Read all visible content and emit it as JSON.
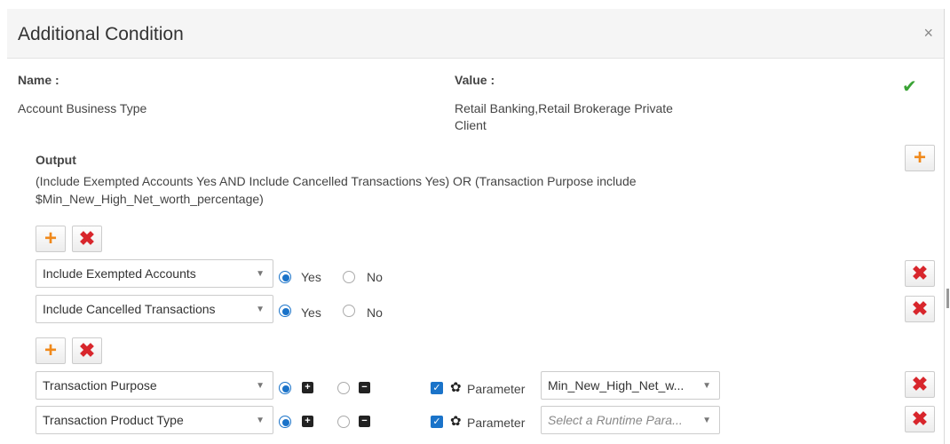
{
  "dialog": {
    "title": "Additional Condition",
    "close_glyph": "×"
  },
  "summary": {
    "name_label": "Name :",
    "value_label": "Value :",
    "name_value": "Account Business Type",
    "value_line1": "Retail Banking,Retail Brokerage Private",
    "value_line2": "Client",
    "confirm_glyph": "✔"
  },
  "output": {
    "label": "Output",
    "expr_line1": "(Include Exempted Accounts Yes AND Include Cancelled Transactions Yes) OR (Transaction Purpose include",
    "expr_line2": "$Min_New_High_Net_worth_percentage)"
  },
  "glyphs": {
    "plus": "+",
    "remove": "✖",
    "caret": "▼",
    "check": "✓",
    "gear": "✿",
    "sq_plus": "+",
    "sq_minus": "−"
  },
  "group1": {
    "rows": [
      {
        "field": "Include Exempted Accounts",
        "opt1": "Yes",
        "opt2": "No",
        "selected": "Yes"
      },
      {
        "field": "Include Cancelled Transactions",
        "opt1": "Yes",
        "opt2": "No",
        "selected": "Yes"
      }
    ]
  },
  "group2": {
    "rows": [
      {
        "field": "Transaction Purpose",
        "param_label": "Parameter",
        "param_checked": true,
        "param_value": "Min_New_High_Net_w...",
        "placeholder": false
      },
      {
        "field": "Transaction Product Type",
        "param_label": "Parameter",
        "param_checked": true,
        "param_value": "Select a Runtime Para...",
        "placeholder": true
      }
    ]
  },
  "colors": {
    "accent": "#1a73c9",
    "add": "#f0891b",
    "delete": "#d8262c",
    "confirm": "#3aa335"
  }
}
